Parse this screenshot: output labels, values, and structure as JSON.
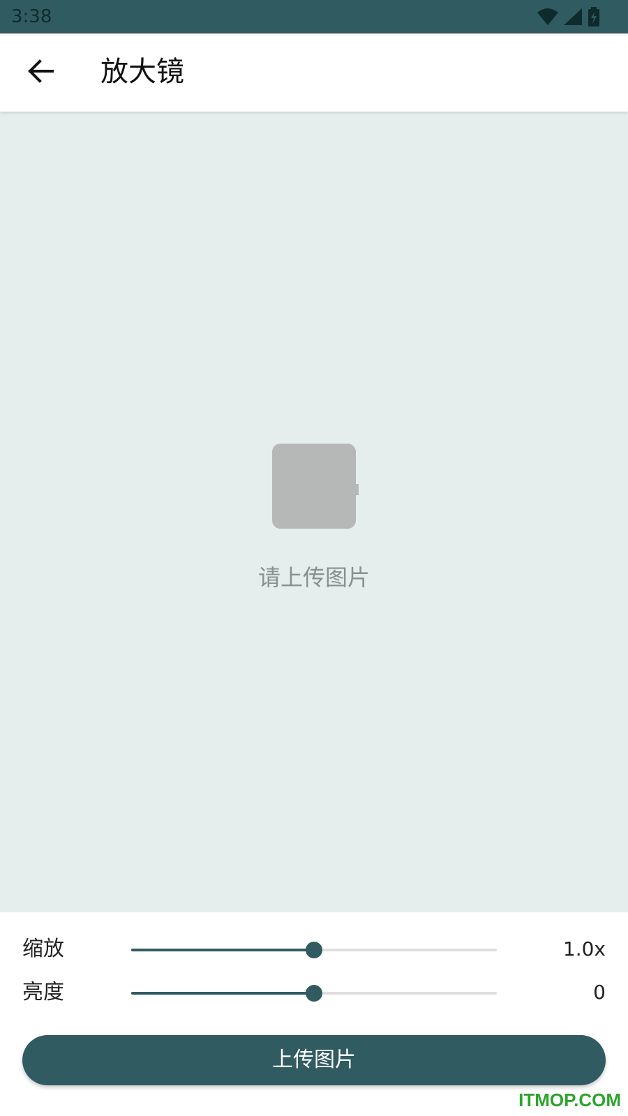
{
  "status_bar": {
    "time": "3:38",
    "icons": [
      "wifi-icon",
      "cell-signal-icon",
      "battery-charging-icon"
    ]
  },
  "app_bar": {
    "back_icon": "arrow-left-icon",
    "title": "放大镜"
  },
  "preview": {
    "placeholder_icon": "image-placeholder-icon",
    "placeholder_text": "请上传图片"
  },
  "controls": {
    "zoom": {
      "label": "缩放",
      "value_text": "1.0x",
      "level": 0.5
    },
    "brightness": {
      "label": "亮度",
      "value_text": "0",
      "level": 0.5
    },
    "upload_label": "上传图片"
  },
  "watermark": "ITMOP.COM",
  "colors": {
    "primary": "#305b61",
    "preview_bg": "#e5eeed",
    "placeholder": "#b5b8b7",
    "track": "#dedede",
    "watermark": "#2ea42e"
  }
}
